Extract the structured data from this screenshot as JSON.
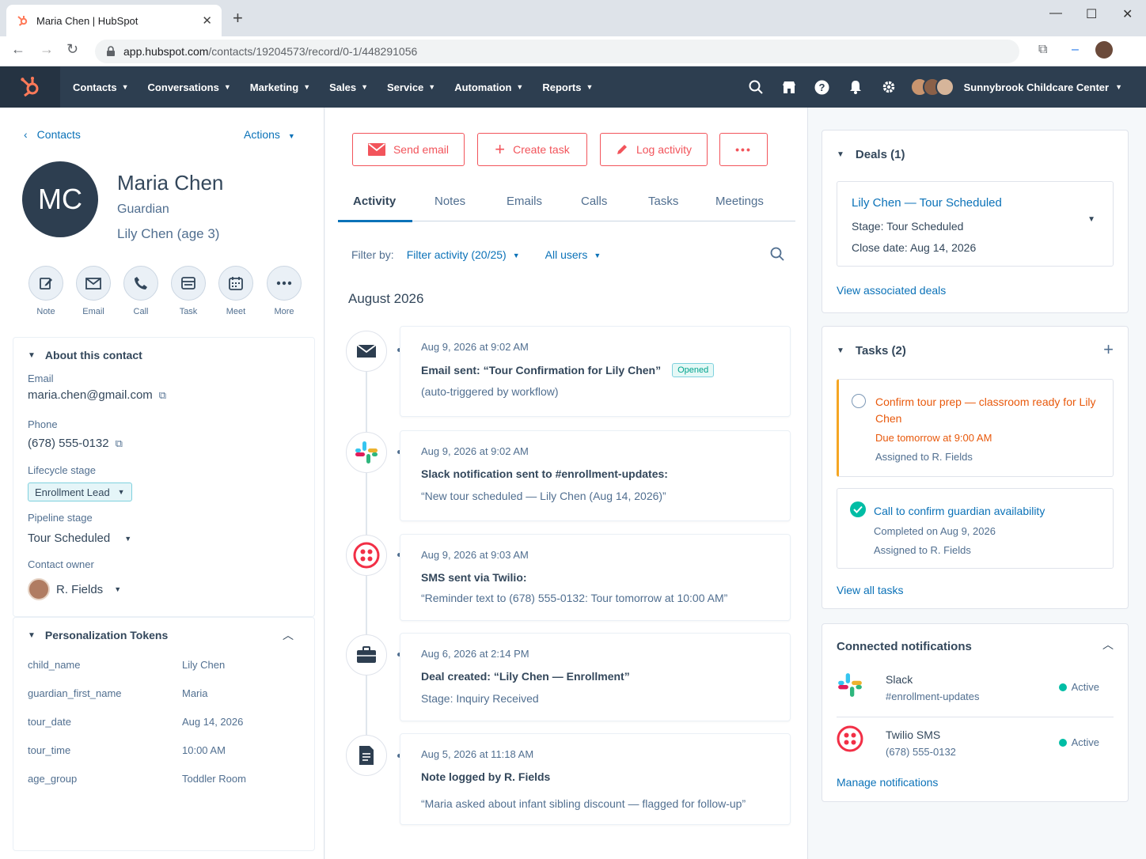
{
  "browser": {
    "tab_title": "Maria Chen | HubSpot",
    "url_host": "app.hubspot.com",
    "url_path": "/contacts/19204573/record/0-1/448291056"
  },
  "nav": {
    "items": [
      "Contacts",
      "Conversations",
      "Marketing",
      "Sales",
      "Service",
      "Automation",
      "Reports"
    ],
    "account_name": "Sunnybrook Childcare Center"
  },
  "contact": {
    "back_label": "Contacts",
    "actions_label": "Actions",
    "initials": "MC",
    "name": "Maria Chen",
    "role": "Guardian",
    "child": "Lily Chen (age 3)",
    "quick_actions": [
      "Note",
      "Email",
      "Call",
      "Task",
      "Meet",
      "More"
    ]
  },
  "about": {
    "title": "About this contact",
    "email_label": "Email",
    "email_value": "maria.chen@gmail.com",
    "phone_label": "Phone",
    "phone_value": "(678) 555-0132",
    "lifecycle_label": "Lifecycle stage",
    "lifecycle_value": "Enrollment Lead",
    "pipeline_label": "Pipeline stage",
    "pipeline_value": "Tour Scheduled",
    "owner_label": "Contact owner",
    "owner_value": "R. Fields"
  },
  "tokens": {
    "title": "Personalization Tokens",
    "rows": [
      {
        "key": "child_name",
        "value": "Lily Chen"
      },
      {
        "key": "guardian_first_name",
        "value": "Maria"
      },
      {
        "key": "tour_date",
        "value": "Aug 14, 2026"
      },
      {
        "key": "tour_time",
        "value": "10:00 AM"
      },
      {
        "key": "age_group",
        "value": "Toddler Room"
      }
    ]
  },
  "activity": {
    "buttons": {
      "send_email": "Send email",
      "create_task": "Create task",
      "log_activity": "Log activity",
      "more": "•••"
    },
    "tabs": [
      "Activity",
      "Notes",
      "Emails",
      "Calls",
      "Tasks",
      "Meetings"
    ],
    "filter_label": "Filter by:",
    "filter_activity": "Filter activity (20/25)",
    "filter_users": "All users",
    "month": "August 2026",
    "items": [
      {
        "date": "Aug 9, 2026 at 9:02 AM",
        "title": "Email sent: “Tour Confirmation for Lily Chen”",
        "badge": "Opened",
        "body": "(auto-triggered by workflow)"
      },
      {
        "date": "Aug 9, 2026 at 9:02 AM",
        "title": "Slack notification sent to #enrollment-updates:",
        "body": "“New tour scheduled — Lily Chen (Aug 14, 2026)”"
      },
      {
        "date": "Aug 9, 2026 at 9:03 AM",
        "title": "SMS sent via Twilio:",
        "body": "“Reminder text to (678) 555-0132: Tour tomorrow at 10:00 AM”"
      },
      {
        "date": "Aug 6, 2026 at 2:14 PM",
        "title": "Deal created: “Lily Chen — Enrollment”",
        "body": "Stage: Inquiry Received"
      },
      {
        "date": "Aug 5, 2026 at 11:18 AM",
        "title": "Note logged by R. Fields",
        "body": "“Maria asked about infant sibling discount — flagged for follow-up”"
      }
    ]
  },
  "deals": {
    "title": "Deals (1)",
    "deal_name": "Lily Chen — Tour Scheduled",
    "stage": "Stage: Tour Scheduled",
    "close_date": "Close date: Aug 14, 2026",
    "view_link": "View associated deals"
  },
  "tasks": {
    "title": "Tasks (2)",
    "items": [
      {
        "title": "Confirm tour prep — classroom ready for Lily Chen",
        "due": "Due tomorrow at 9:00 AM",
        "assigned": "Assigned to R. Fields"
      },
      {
        "title": "Call to confirm guardian availability",
        "due": "Completed on Aug 9, 2026",
        "assigned": "Assigned to R. Fields"
      }
    ],
    "view_link": "View all tasks"
  },
  "notifications": {
    "title": "Connected notifications",
    "items": [
      {
        "name": "Slack",
        "sub": "#enrollment-updates",
        "status": "Active"
      },
      {
        "name": "Twilio SMS",
        "sub": "(678) 555-0132",
        "status": "Active"
      }
    ],
    "manage_link": "Manage notifications"
  },
  "colors": {
    "nav_bg": "#2d3e50",
    "accent": "#f2545b",
    "link": "#0b72b8",
    "overdue": "#e8590c",
    "success": "#00bda5"
  }
}
